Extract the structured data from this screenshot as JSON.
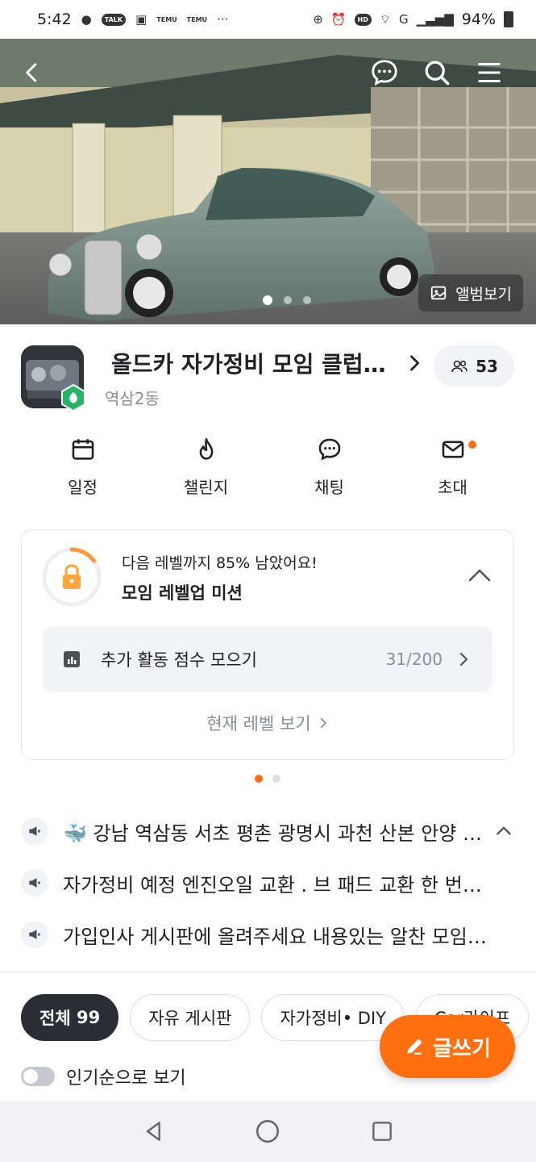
{
  "status_bar": {
    "time": "5:42",
    "notification_badge": "TALK",
    "temu_label": "TEMU",
    "overflow": "···",
    "network": "HD",
    "signal_label": "G",
    "battery": "94%"
  },
  "hero": {
    "album_label": "앨범보기",
    "slide_count": 3,
    "active_slide": 1
  },
  "club": {
    "title": "올드카 자가정비 모임  클럽 JSON",
    "location": "역삼2동",
    "member_count": "53"
  },
  "quick_actions": [
    {
      "label": "일정",
      "icon": "calendar-icon"
    },
    {
      "label": "챌린지",
      "icon": "flame-icon"
    },
    {
      "label": "채팅",
      "icon": "chat-icon"
    },
    {
      "label": "초대",
      "icon": "mail-icon",
      "has_notification": true
    }
  ],
  "level_card": {
    "progress_text": "다음 레벨까지 85% 남았어요!",
    "progress_fraction": 0.15,
    "title": "모임 레벨업 미션",
    "mission_label": "추가 활동 점수 모으기",
    "mission_count": "31/200",
    "current_level_link": "현재 레벨 보기"
  },
  "card_pager": {
    "count": 2,
    "active": 0
  },
  "notices": [
    "🐳 강남 역삼동 서초 평촌 광명시 과천 산본 안양 의왕 수원",
    "자가정비 예정 엔진오일 교환 . 브 패드 교환 한 번에 모여서",
    "가입인사 게시판에 올려주세요 내용있는 알찬 모임을 위해서"
  ],
  "tabs": [
    {
      "label": "전체",
      "count": "99",
      "active": true
    },
    {
      "label": "자유 게시판"
    },
    {
      "label": "자가정비• DIY"
    },
    {
      "label": "Car라이프"
    }
  ],
  "write_button": "글쓰기",
  "popular_toggle": {
    "label": "인기순으로 보기",
    "on": false
  },
  "colors": {
    "accent": "#ff6f0f",
    "dark": "#2a2d33",
    "muted": "#8a8f96"
  }
}
